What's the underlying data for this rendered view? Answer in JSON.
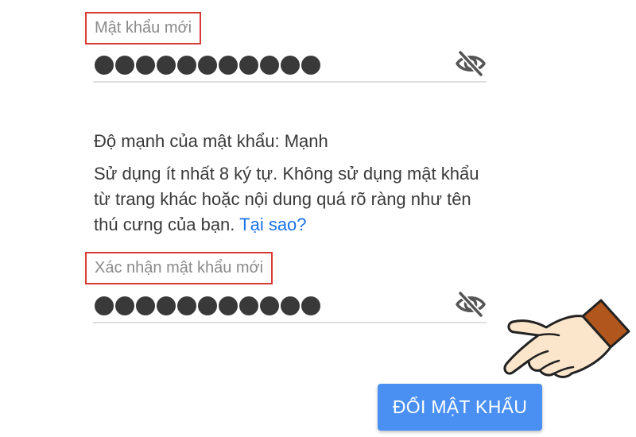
{
  "new_password": {
    "label": "Mật khẩu mới",
    "masked_length": 11,
    "toggle_icon": "eye-off-icon"
  },
  "strength": {
    "label": "Độ mạnh của mật khẩu:",
    "value": "Mạnh"
  },
  "hint": {
    "text": "Sử dụng ít nhất 8 ký tự. Không sử dụng mật khẩu từ trang khác hoặc nội dung quá rõ ràng như tên thú cưng của bạn.",
    "link_text": "Tại sao?"
  },
  "confirm_password": {
    "label": "Xác nhận mật khẩu mới",
    "masked_length": 11,
    "toggle_icon": "eye-off-icon"
  },
  "submit": {
    "label": "ĐỔI MẬT KHẨU"
  },
  "colors": {
    "highlight_border": "#d63c35",
    "link": "#1a73e8",
    "button": "#4a8ff2",
    "dot": "#393939"
  }
}
